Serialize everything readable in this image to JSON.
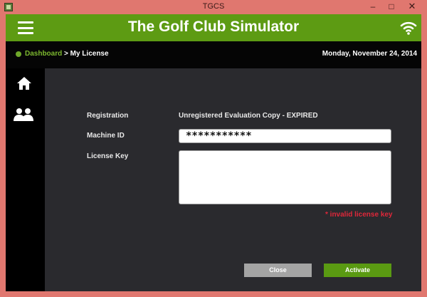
{
  "window": {
    "title": "TGCS",
    "minimize_glyph": "–",
    "maximize_glyph": "□",
    "close_glyph": "✕"
  },
  "header": {
    "title": "The Golf Club Simulator",
    "menu_icon": "hamburger-menu-icon",
    "status_icon": "wifi-icon"
  },
  "breadcrumb": {
    "home": "Dashboard",
    "separator": " > ",
    "current": "My License"
  },
  "date": "Monday, November 24, 2014",
  "sidebar": {
    "items": [
      {
        "icon": "home-icon"
      },
      {
        "icon": "users-icon"
      }
    ]
  },
  "license": {
    "registration_label": "Registration",
    "registration_value": "Unregistered Evaluation Copy - EXPIRED",
    "machine_id_label": "Machine ID",
    "machine_id_value": "***********",
    "license_key_label": "License Key",
    "license_key_value": "",
    "error": "* invalid license key"
  },
  "actions": {
    "close_label": "Close",
    "activate_label": "Activate"
  },
  "colors": {
    "window_frame": "#e0776f",
    "brand_green": "#5d9b13",
    "link_green": "#7cb82f",
    "error_red": "#e0273a",
    "panel": "#2a2a2e"
  }
}
